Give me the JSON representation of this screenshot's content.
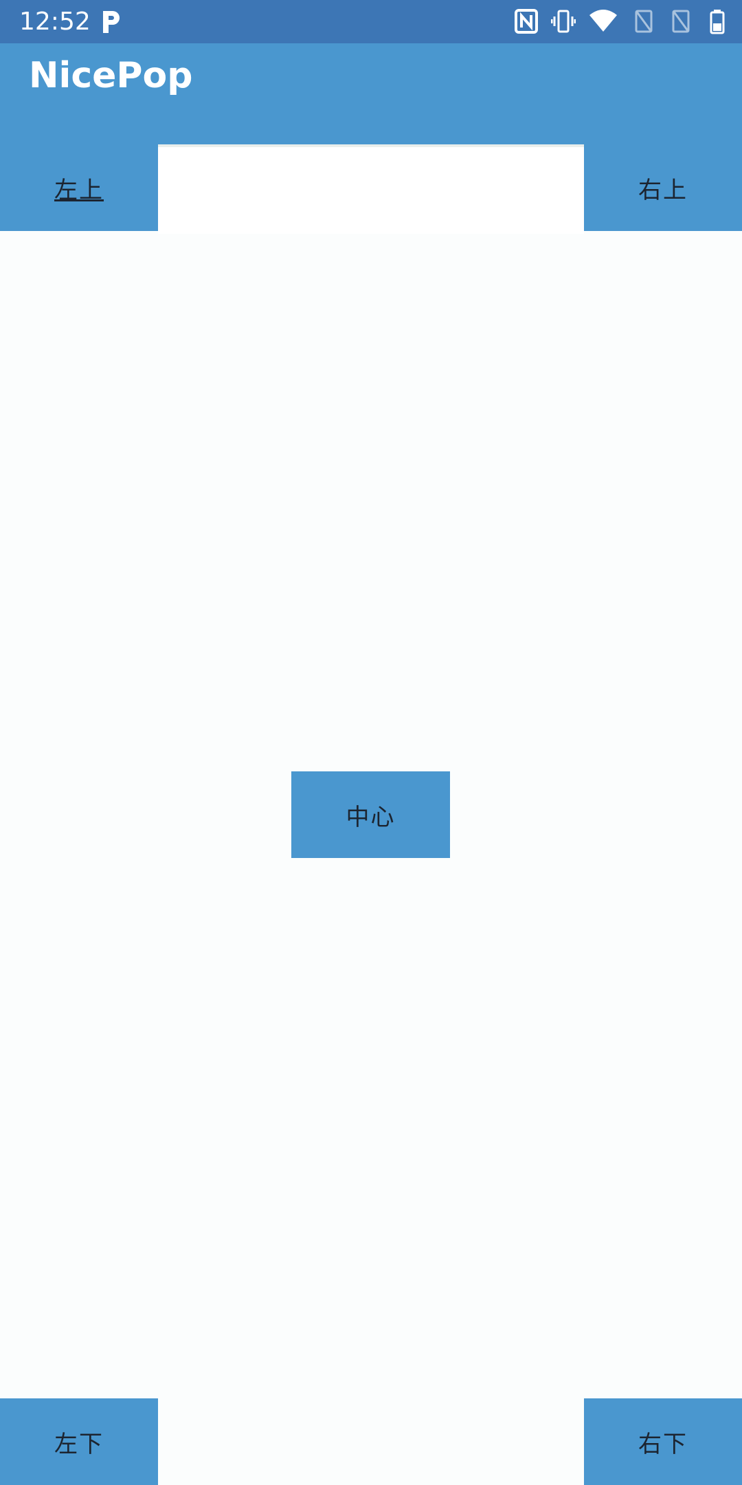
{
  "status_bar": {
    "time": "12:52",
    "icons": [
      "parking-icon",
      "nfc-icon",
      "vibrate-icon",
      "wifi-icon",
      "sim1-icon",
      "sim2-icon",
      "battery-icon"
    ]
  },
  "app_bar": {
    "title": "NicePop"
  },
  "buttons": {
    "top_left": "左上",
    "top_right": "右上",
    "center": "中心",
    "bottom_left": "左下",
    "bottom_right": "右下"
  },
  "colors": {
    "status_bar": "#3d76b5",
    "app_bar": "#4a97cf",
    "button": "#4a97cf",
    "background": "#fbfdfd"
  }
}
